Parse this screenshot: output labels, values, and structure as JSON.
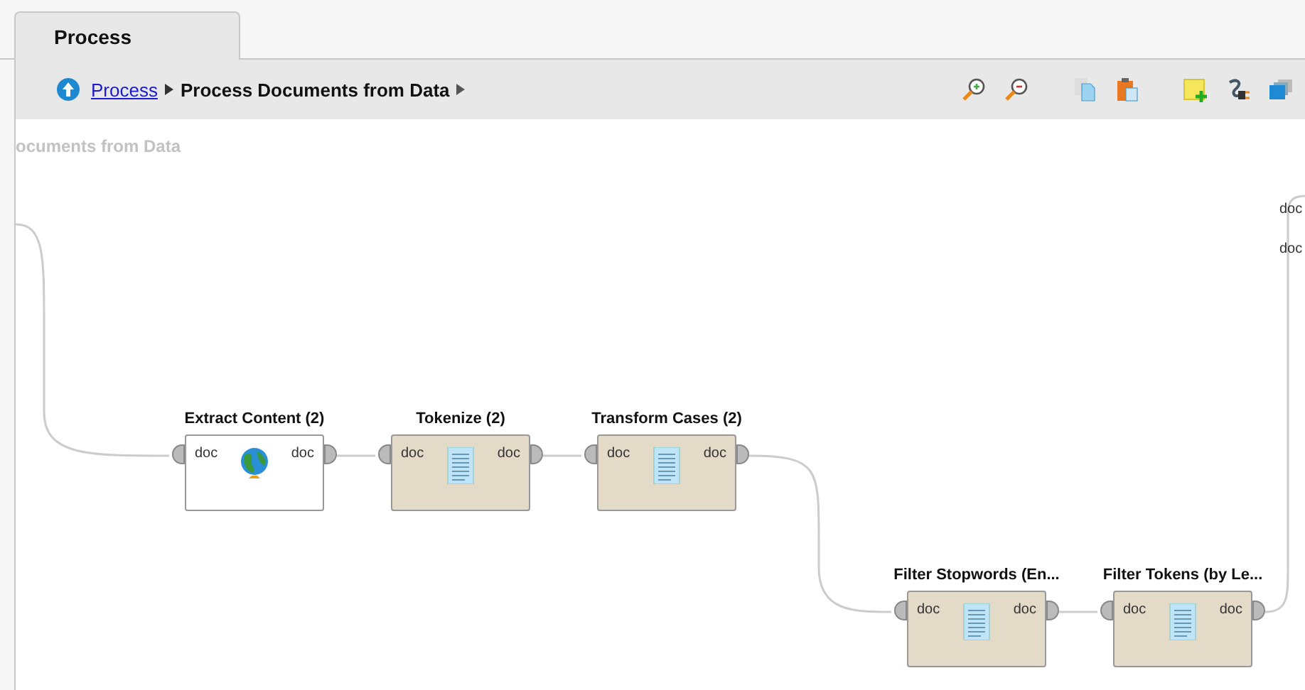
{
  "tabs": [
    {
      "label": "Process",
      "selected": true
    }
  ],
  "breadcrumb": {
    "items": [
      {
        "label": "Process",
        "kind": "link"
      },
      {
        "label": "Process Documents from Data",
        "kind": "current"
      }
    ]
  },
  "canvas": {
    "title": "ocuments from Data",
    "port_labels": [
      "doc",
      "doc"
    ],
    "operators": [
      {
        "name": "Extract Content (2)",
        "kind": "globe",
        "ports": [
          "doc",
          "doc"
        ]
      },
      {
        "name": "Tokenize (2)",
        "kind": "document",
        "ports": [
          "doc",
          "doc"
        ]
      },
      {
        "name": "Transform Cases (2)",
        "kind": "document",
        "ports": [
          "doc",
          "doc"
        ]
      },
      {
        "name": "Filter Stopwords (En...",
        "kind": "document",
        "ports": [
          "doc",
          "doc"
        ]
      },
      {
        "name": "Filter Tokens (by Le...",
        "kind": "document",
        "ports": [
          "doc",
          "doc"
        ]
      }
    ]
  }
}
